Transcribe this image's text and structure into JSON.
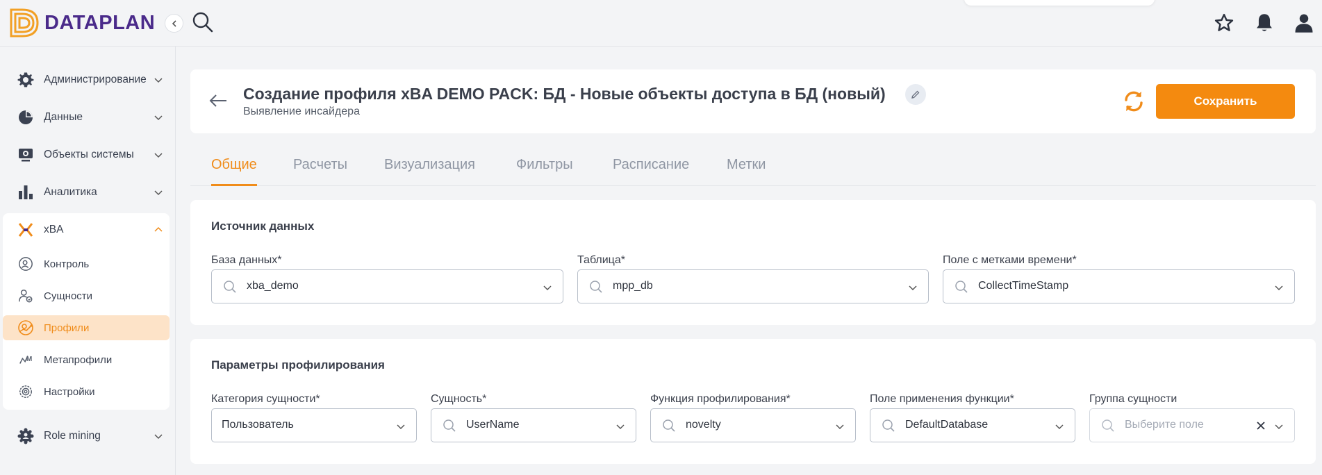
{
  "app": {
    "logo_text": "DATAPLAN"
  },
  "sidebar": {
    "items": [
      {
        "label": "Администрирование",
        "icon": "gear-icon"
      },
      {
        "label": "Данные",
        "icon": "pie-chart-icon"
      },
      {
        "label": "Объекты системы",
        "icon": "monitor-icon"
      },
      {
        "label": "Аналитика",
        "icon": "bar-chart-icon"
      },
      {
        "label": "xBA",
        "icon": "xba-icon"
      },
      {
        "label": "Role mining",
        "icon": "cog-role-icon"
      }
    ],
    "xba_sub": [
      {
        "label": "Контроль",
        "icon": "control-icon"
      },
      {
        "label": "Сущности",
        "icon": "entities-icon"
      },
      {
        "label": "Профили",
        "icon": "profiles-icon"
      },
      {
        "label": "Метапрофили",
        "icon": "metaprofiles-icon"
      },
      {
        "label": "Настройки",
        "icon": "settings-icon"
      }
    ]
  },
  "header": {
    "title": "Создание профиля xBA DEMO PACK: БД - Новые объекты доступа в БД (новый)",
    "subtitle": "Выявление инсайдера",
    "save_label": "Сохранить"
  },
  "tabs": [
    "Общие",
    "Расчеты",
    "Визуализация",
    "Фильтры",
    "Расписание",
    "Метки"
  ],
  "source": {
    "title": "Источник данных",
    "fields": [
      {
        "label": "База данных*",
        "value": "xba_demo"
      },
      {
        "label": "Таблица*",
        "value": "mpp_db"
      },
      {
        "label": "Поле с метками времени*",
        "value": "CollectTimeStamp"
      }
    ]
  },
  "profiling": {
    "title": "Параметры профилирования",
    "fields": [
      {
        "label": "Категория сущности*",
        "value": "Пользователь"
      },
      {
        "label": "Сущность*",
        "value": "UserName"
      },
      {
        "label": "Функция профилирования*",
        "value": "novelty"
      },
      {
        "label": "Поле применения функции*",
        "value": "DefaultDatabase"
      },
      {
        "label": "Группа сущности",
        "placeholder": "Выберите поле"
      }
    ]
  },
  "colors": {
    "accent": "#f48a0f",
    "brand": "#4a2a8a",
    "active_bg": "#fde3c8"
  }
}
